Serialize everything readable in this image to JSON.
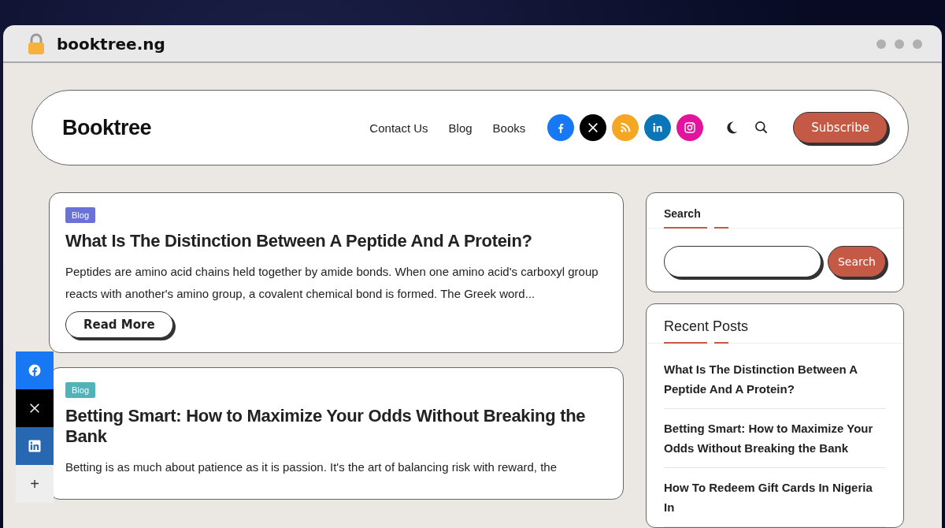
{
  "browser": {
    "url": "booktree.ng"
  },
  "header": {
    "logo": "Booktree",
    "nav": [
      "Contact Us",
      "Blog",
      "Books"
    ],
    "social": [
      {
        "kind": "facebook",
        "color": "#1877f2"
      },
      {
        "kind": "x",
        "color": "#000000"
      },
      {
        "kind": "rss",
        "color": "#f5a623"
      },
      {
        "kind": "linkedin",
        "color": "#0a76b7"
      },
      {
        "kind": "instagram",
        "color": "#e4139b"
      }
    ],
    "subscribe": "Subscribe"
  },
  "posts": [
    {
      "category": {
        "label": "Blog",
        "color": "#6a72d8"
      },
      "title": "What Is The Distinction Between A Peptide And A Protein?",
      "excerpt": "Peptides are amino acid chains held together by amide bonds. When one amino acid's carboxyl group reacts with another's amino group, a covalent chemical bond is formed. The Greek word...",
      "button": "Read More"
    },
    {
      "category": {
        "label": "Blog",
        "color": "#4fb3b8"
      },
      "title": "Betting Smart: How to Maximize Your Odds Without Breaking the Bank",
      "excerpt": "Betting is as much about patience as it is passion. It's the art of balancing risk with reward, the"
    }
  ],
  "sidebar": {
    "search": {
      "title": "Search",
      "button": "Search"
    },
    "recent": {
      "title": "Recent Posts",
      "items": [
        "What Is The Distinction Between A Peptide And A Protein?",
        "Betting Smart: How to Maximize Your Odds Without Breaking the Bank",
        "How To Redeem Gift Cards In Nigeria In"
      ]
    }
  },
  "share_bar": [
    {
      "kind": "facebook",
      "color": "#1877f2"
    },
    {
      "kind": "x",
      "color": "#000000"
    },
    {
      "kind": "linkedin",
      "color": "#2867b2"
    },
    {
      "kind": "more",
      "label": "+",
      "color": "#eeeeee"
    }
  ]
}
